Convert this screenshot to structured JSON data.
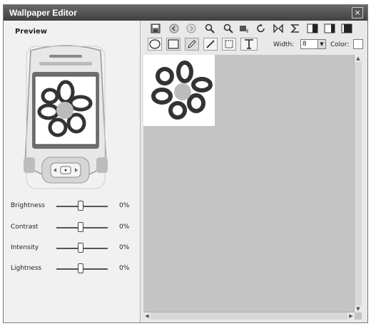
{
  "window": {
    "title": "Wallpaper Editor",
    "close_label": "×"
  },
  "preview": {
    "label": "Preview"
  },
  "adjustments": [
    {
      "label": "Brightness",
      "value": "0%"
    },
    {
      "label": "Contrast",
      "value": "0%"
    },
    {
      "label": "Intensity",
      "value": "0%"
    },
    {
      "label": "Lightness",
      "value": "0%"
    }
  ],
  "toolbar2": {
    "width_label": "Width:",
    "width_value": "8",
    "color_label": "Color:"
  },
  "colors": {
    "title_bar": "#4f4f4f",
    "canvas_bg": "#c4c4c4",
    "panel_bg": "#f1f1f1"
  }
}
